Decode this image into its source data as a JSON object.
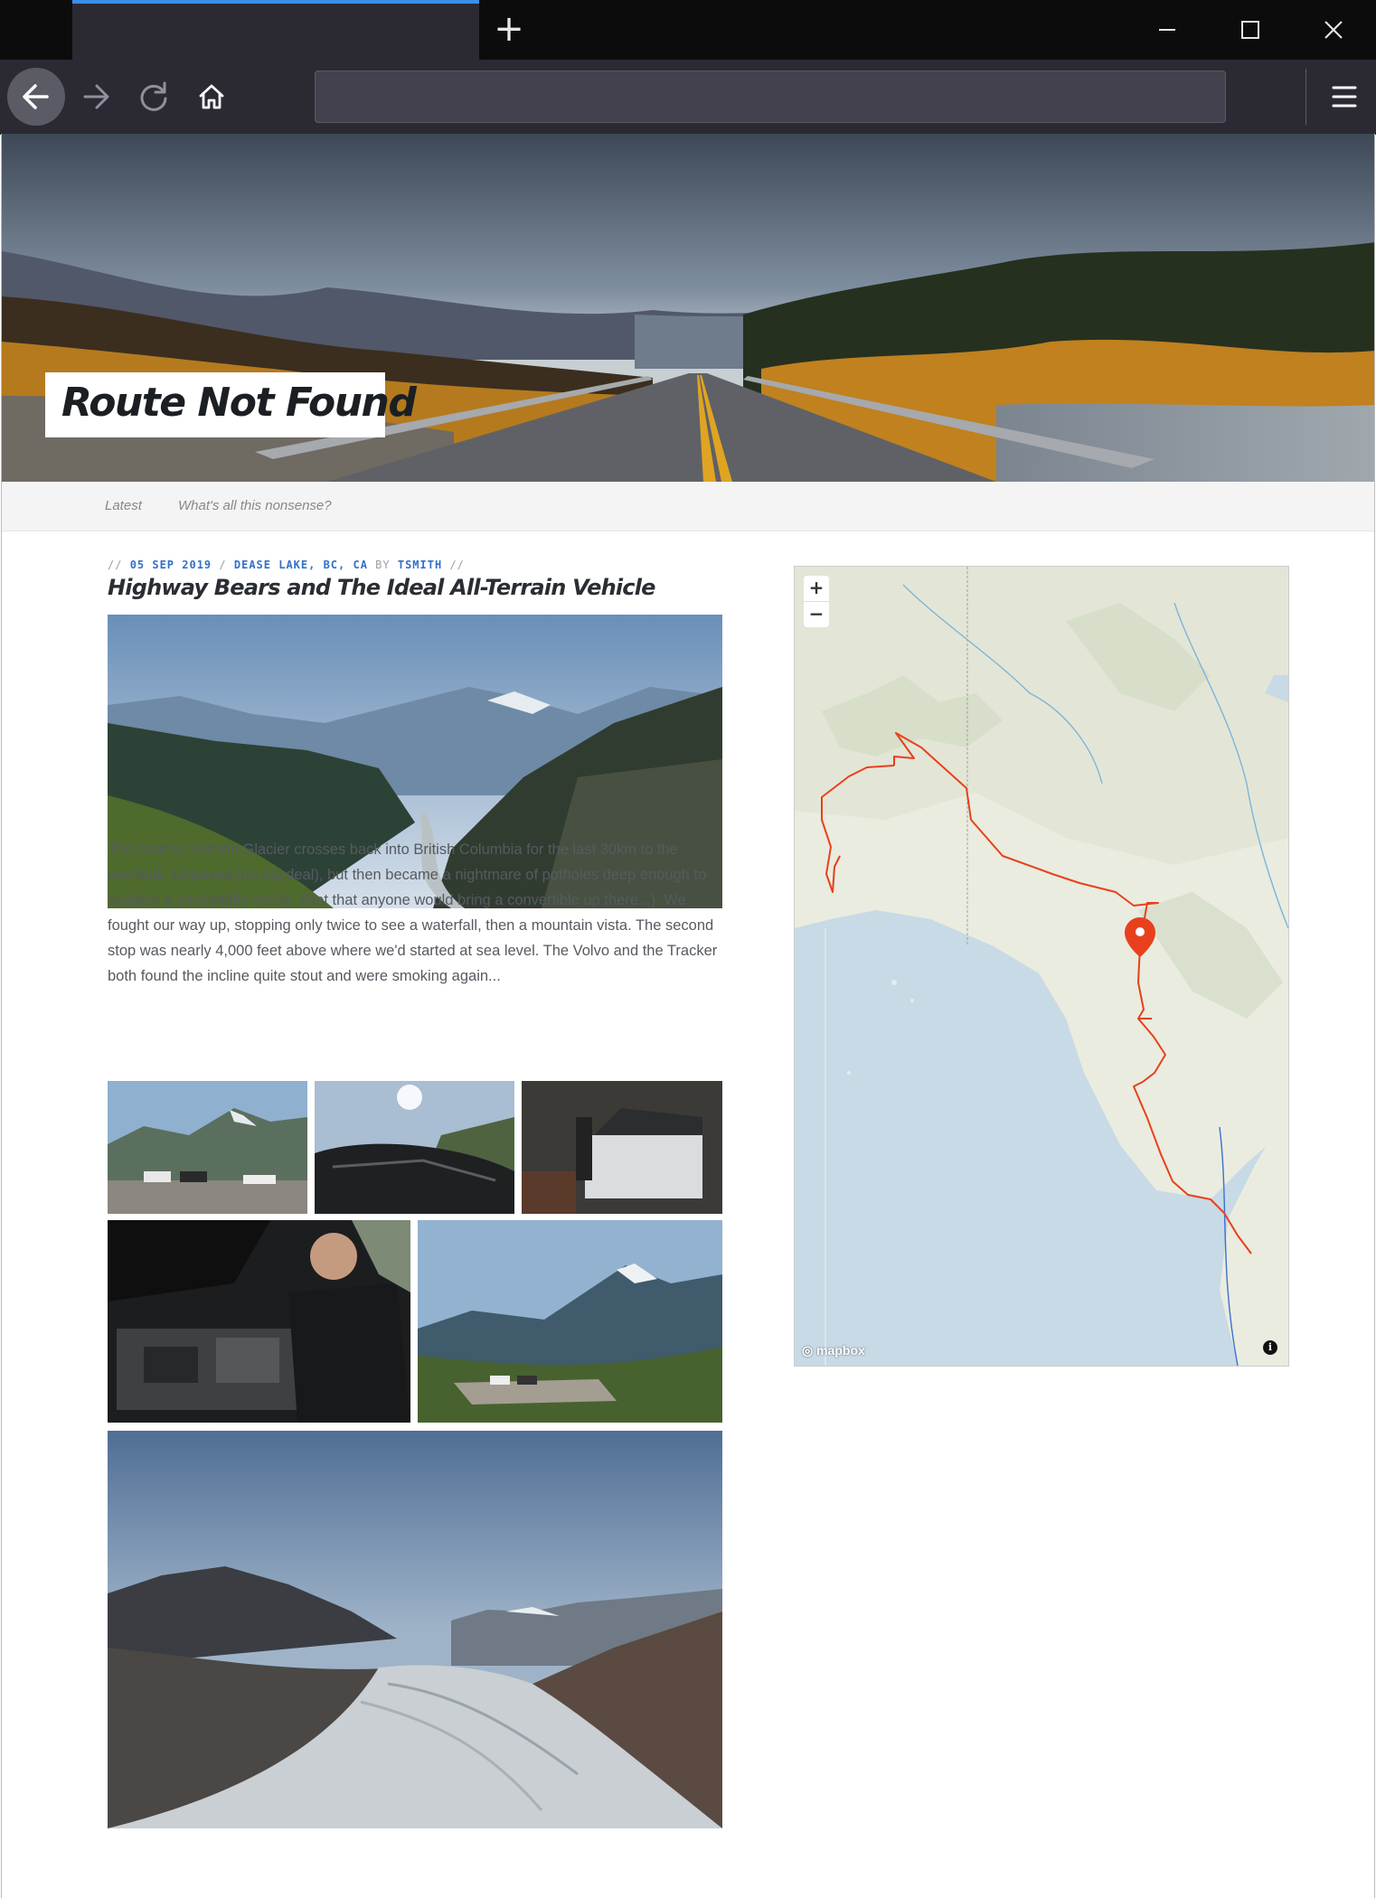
{
  "browser": {
    "url": "",
    "new_tab_symbol": "+",
    "icons": [
      "back-arrow-icon",
      "forward-arrow-icon",
      "reload-icon",
      "home-icon",
      "menu-icon",
      "minimize-icon",
      "maximize-icon",
      "close-icon"
    ]
  },
  "site": {
    "title": "Route Not Found",
    "nav": [
      "Latest",
      "What's all this nonsense?"
    ]
  },
  "post": {
    "meta_prefix": "//",
    "date": "05 SEP 2019",
    "sep1": "/",
    "location": "DEASE LAKE, BC, CA",
    "by": "BY",
    "author": "TSMITH",
    "meta_suffix": "//",
    "title": "Highway Bears and The Ideal All-Terrain Vehicle",
    "body": "The road to Salmon Glacier crosses back into British Columbia for the last 30km to the overlook. Unpaved (no big deal), but then became a nightmare of potholes deep enough to swallow a convertible whole. (Not that anyone would bring a convertible up there...). We fought our way up, stopping only twice to see a waterfall, then a mountain vista. The second stop was nearly 4,000 feet above where we'd started at sea level. The Volvo and the Tracker both found the incline quite stout and were smoking again..."
  },
  "map": {
    "zoom_in": "+",
    "zoom_out": "−",
    "attribution": "mapbox",
    "info": "i",
    "accent": "#e8401c"
  }
}
